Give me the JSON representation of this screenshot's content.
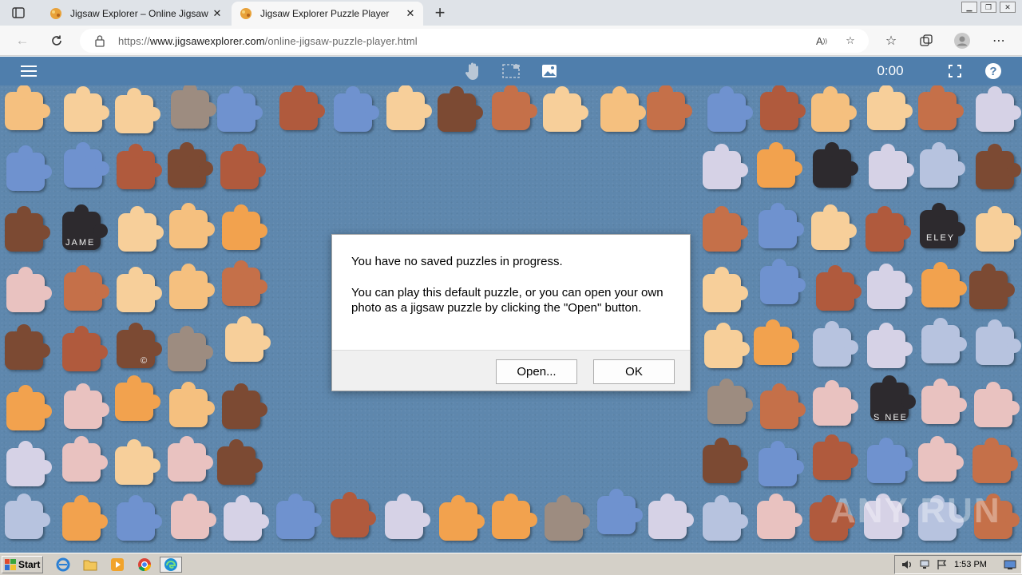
{
  "browser": {
    "tabs": [
      {
        "title": "Jigsaw Explorer – Online Jigsaw Puzzles",
        "active": false
      },
      {
        "title": "Jigsaw Explorer Puzzle Player",
        "active": true
      }
    ],
    "url": {
      "prefix": "https://",
      "host": "www.jigsawexplorer.com",
      "path": "/online-jigsaw-puzzle-player.html"
    }
  },
  "app": {
    "timer": "0:00",
    "icons": [
      "menu-icon",
      "hand-icon",
      "selection-icon",
      "image-icon",
      "fullscreen-icon",
      "help-icon"
    ]
  },
  "pieces_text": {
    "left_label": "JAME",
    "right_label": "ELEY",
    "bottom_right_label": "S NEE",
    "copyright": "©"
  },
  "dialog": {
    "line1": "You have no saved puzzles in progress.",
    "line2": "You can play this default puzzle, or you can open your own photo as a jigsaw puzzle by clicking the \"Open\" button.",
    "open_label": "Open...",
    "ok_label": "OK"
  },
  "watermark": "ANY RUN",
  "taskbar": {
    "start_label": "Start",
    "clock": "1:53 PM"
  },
  "colors": {
    "appbar": "#4f7eac",
    "playarea": "#5e87ad",
    "dialog_footer": "#f0f0f0"
  }
}
